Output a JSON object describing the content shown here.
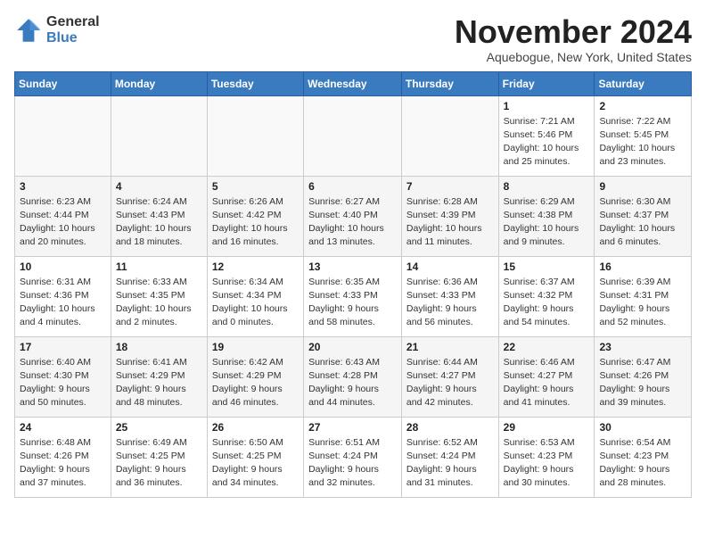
{
  "logo": {
    "general": "General",
    "blue": "Blue"
  },
  "title": "November 2024",
  "location": "Aquebogue, New York, United States",
  "days_of_week": [
    "Sunday",
    "Monday",
    "Tuesday",
    "Wednesday",
    "Thursday",
    "Friday",
    "Saturday"
  ],
  "weeks": [
    [
      {
        "day": "",
        "info": ""
      },
      {
        "day": "",
        "info": ""
      },
      {
        "day": "",
        "info": ""
      },
      {
        "day": "",
        "info": ""
      },
      {
        "day": "",
        "info": ""
      },
      {
        "day": "1",
        "info": "Sunrise: 7:21 AM\nSunset: 5:46 PM\nDaylight: 10 hours and 25 minutes."
      },
      {
        "day": "2",
        "info": "Sunrise: 7:22 AM\nSunset: 5:45 PM\nDaylight: 10 hours and 23 minutes."
      }
    ],
    [
      {
        "day": "3",
        "info": "Sunrise: 6:23 AM\nSunset: 4:44 PM\nDaylight: 10 hours and 20 minutes."
      },
      {
        "day": "4",
        "info": "Sunrise: 6:24 AM\nSunset: 4:43 PM\nDaylight: 10 hours and 18 minutes."
      },
      {
        "day": "5",
        "info": "Sunrise: 6:26 AM\nSunset: 4:42 PM\nDaylight: 10 hours and 16 minutes."
      },
      {
        "day": "6",
        "info": "Sunrise: 6:27 AM\nSunset: 4:40 PM\nDaylight: 10 hours and 13 minutes."
      },
      {
        "day": "7",
        "info": "Sunrise: 6:28 AM\nSunset: 4:39 PM\nDaylight: 10 hours and 11 minutes."
      },
      {
        "day": "8",
        "info": "Sunrise: 6:29 AM\nSunset: 4:38 PM\nDaylight: 10 hours and 9 minutes."
      },
      {
        "day": "9",
        "info": "Sunrise: 6:30 AM\nSunset: 4:37 PM\nDaylight: 10 hours and 6 minutes."
      }
    ],
    [
      {
        "day": "10",
        "info": "Sunrise: 6:31 AM\nSunset: 4:36 PM\nDaylight: 10 hours and 4 minutes."
      },
      {
        "day": "11",
        "info": "Sunrise: 6:33 AM\nSunset: 4:35 PM\nDaylight: 10 hours and 2 minutes."
      },
      {
        "day": "12",
        "info": "Sunrise: 6:34 AM\nSunset: 4:34 PM\nDaylight: 10 hours and 0 minutes."
      },
      {
        "day": "13",
        "info": "Sunrise: 6:35 AM\nSunset: 4:33 PM\nDaylight: 9 hours and 58 minutes."
      },
      {
        "day": "14",
        "info": "Sunrise: 6:36 AM\nSunset: 4:33 PM\nDaylight: 9 hours and 56 minutes."
      },
      {
        "day": "15",
        "info": "Sunrise: 6:37 AM\nSunset: 4:32 PM\nDaylight: 9 hours and 54 minutes."
      },
      {
        "day": "16",
        "info": "Sunrise: 6:39 AM\nSunset: 4:31 PM\nDaylight: 9 hours and 52 minutes."
      }
    ],
    [
      {
        "day": "17",
        "info": "Sunrise: 6:40 AM\nSunset: 4:30 PM\nDaylight: 9 hours and 50 minutes."
      },
      {
        "day": "18",
        "info": "Sunrise: 6:41 AM\nSunset: 4:29 PM\nDaylight: 9 hours and 48 minutes."
      },
      {
        "day": "19",
        "info": "Sunrise: 6:42 AM\nSunset: 4:29 PM\nDaylight: 9 hours and 46 minutes."
      },
      {
        "day": "20",
        "info": "Sunrise: 6:43 AM\nSunset: 4:28 PM\nDaylight: 9 hours and 44 minutes."
      },
      {
        "day": "21",
        "info": "Sunrise: 6:44 AM\nSunset: 4:27 PM\nDaylight: 9 hours and 42 minutes."
      },
      {
        "day": "22",
        "info": "Sunrise: 6:46 AM\nSunset: 4:27 PM\nDaylight: 9 hours and 41 minutes."
      },
      {
        "day": "23",
        "info": "Sunrise: 6:47 AM\nSunset: 4:26 PM\nDaylight: 9 hours and 39 minutes."
      }
    ],
    [
      {
        "day": "24",
        "info": "Sunrise: 6:48 AM\nSunset: 4:26 PM\nDaylight: 9 hours and 37 minutes."
      },
      {
        "day": "25",
        "info": "Sunrise: 6:49 AM\nSunset: 4:25 PM\nDaylight: 9 hours and 36 minutes."
      },
      {
        "day": "26",
        "info": "Sunrise: 6:50 AM\nSunset: 4:25 PM\nDaylight: 9 hours and 34 minutes."
      },
      {
        "day": "27",
        "info": "Sunrise: 6:51 AM\nSunset: 4:24 PM\nDaylight: 9 hours and 32 minutes."
      },
      {
        "day": "28",
        "info": "Sunrise: 6:52 AM\nSunset: 4:24 PM\nDaylight: 9 hours and 31 minutes."
      },
      {
        "day": "29",
        "info": "Sunrise: 6:53 AM\nSunset: 4:23 PM\nDaylight: 9 hours and 30 minutes."
      },
      {
        "day": "30",
        "info": "Sunrise: 6:54 AM\nSunset: 4:23 PM\nDaylight: 9 hours and 28 minutes."
      }
    ]
  ]
}
